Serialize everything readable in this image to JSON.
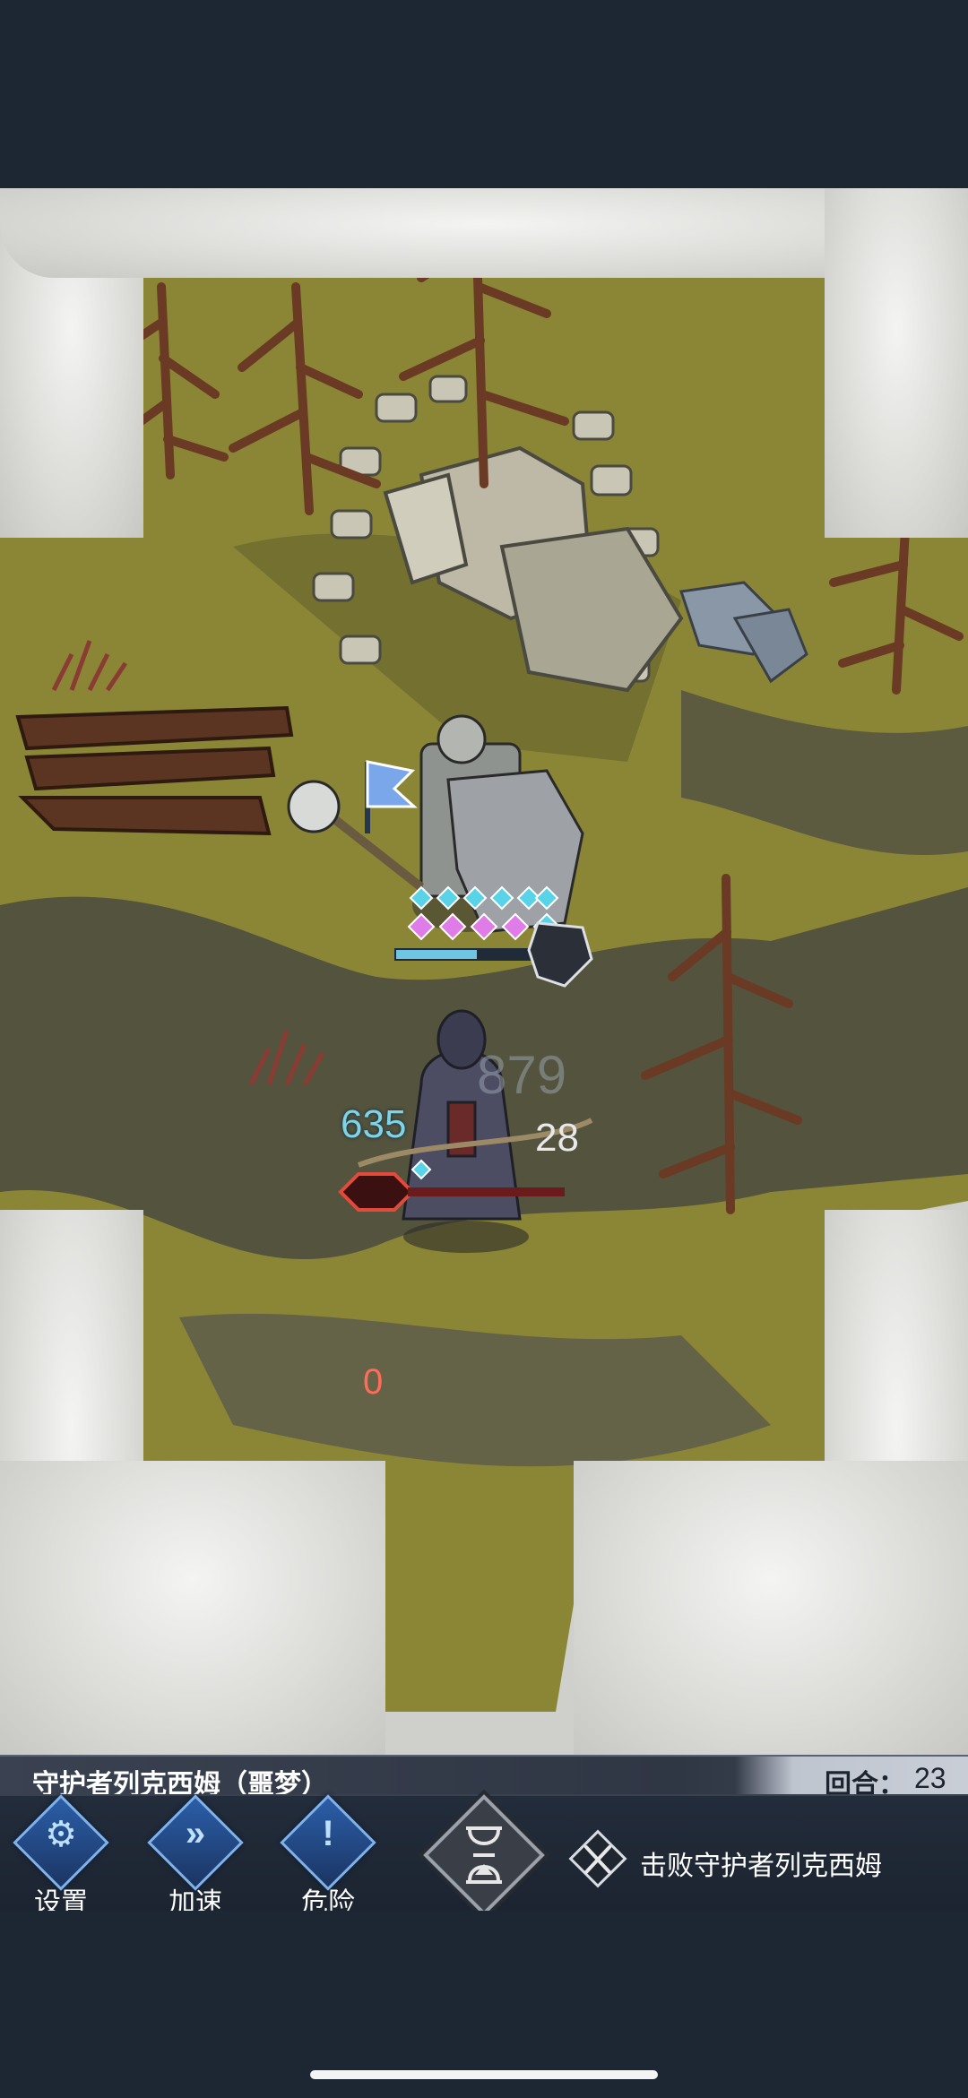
{
  "map": {
    "enemy_hp": "635",
    "enemy_shield": "28",
    "phantom_value": "879",
    "player_hp": "0"
  },
  "info_bar": {
    "boss_name": "守护者列克西姆（噩梦）",
    "round_label": "回合：",
    "round_value": "23"
  },
  "hud": {
    "buttons": [
      {
        "label": "设置",
        "icon": "gear-icon",
        "glyph": "⚙"
      },
      {
        "label": "加速",
        "icon": "fast-forward-icon",
        "glyph": "»"
      },
      {
        "label": "危险",
        "icon": "exclamation-icon",
        "glyph": "!"
      }
    ],
    "hourglass_icon": "hourglass-icon",
    "objective_icon": "crossed-swords-icon",
    "objective_text": "击败守护者列克西姆"
  },
  "colors": {
    "enemy_hp": "#7fd3e8",
    "player_hp": "#ff6d5a",
    "button_blue": "#2b5ea8"
  }
}
